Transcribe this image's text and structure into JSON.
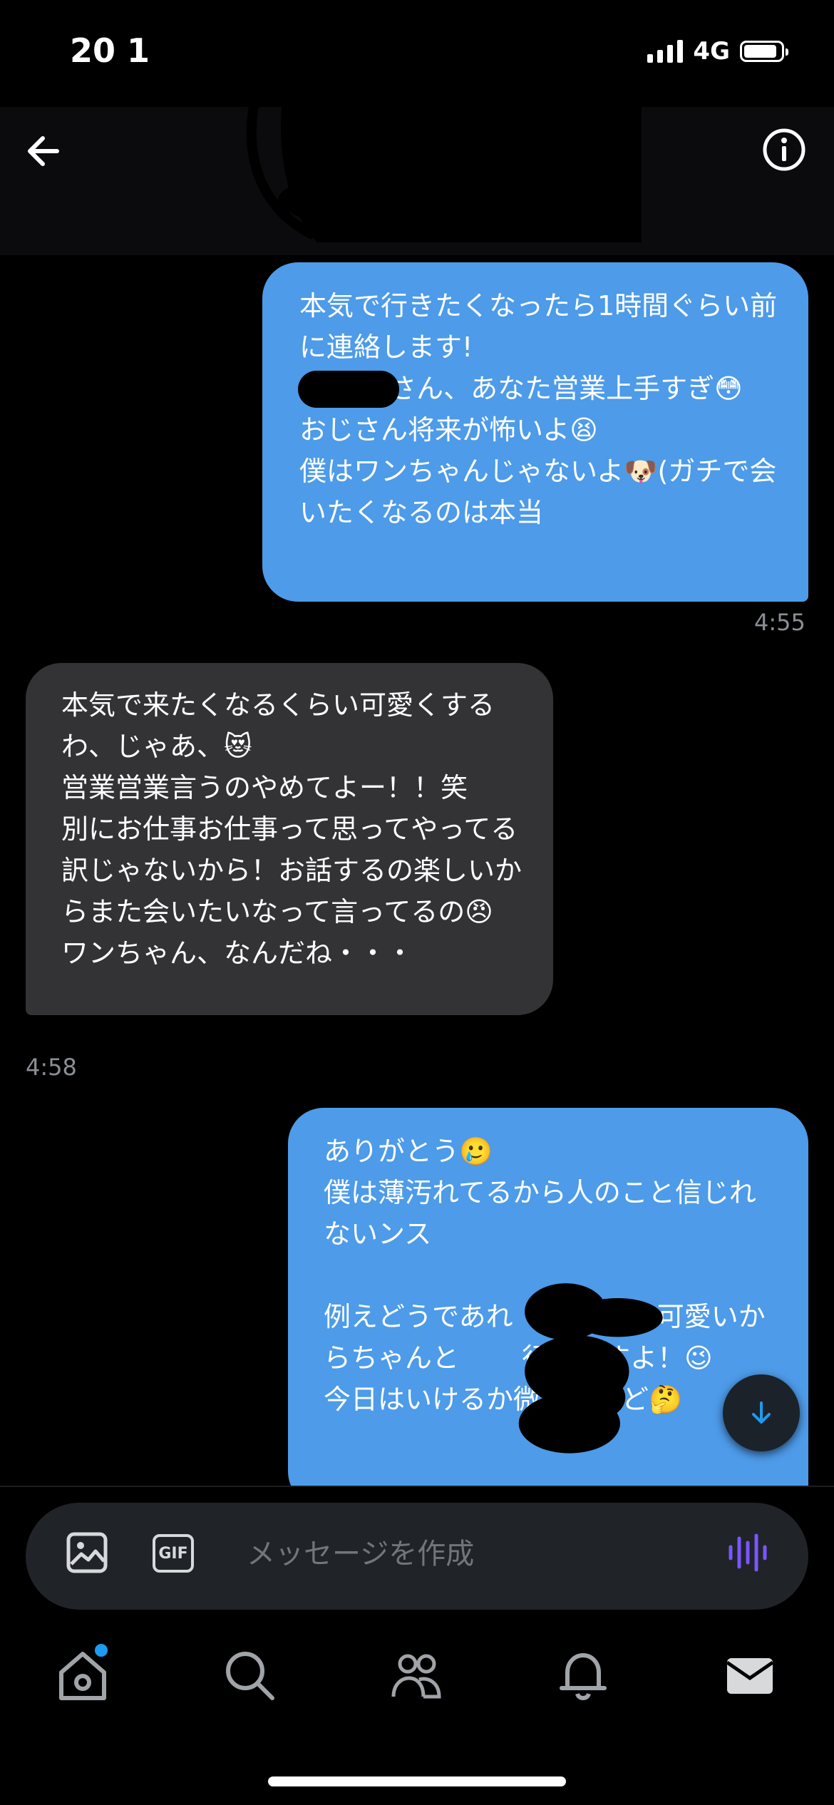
{
  "status_bar": {
    "time": "20 1",
    "network": "4G"
  },
  "header": {
    "back_icon": "arrow-left-icon",
    "info_icon": "info-circle-icon"
  },
  "messages": [
    {
      "direction": "sent",
      "text": "本気で行きたくなったら1時間ぐらい前に連絡します!\n　　　 さん、あなた営業上手すぎ😳\nおじさん将来が怖いよ😫\n僕はワンちゃんじゃないよ🐶(ガチで会いたくなるのは本当",
      "time": "4:55"
    },
    {
      "direction": "received",
      "text": "本気で来たくなるくらい可愛くするわ、じゃあ、😻\n営業営業言うのやめてよー！！笑\n別にお仕事お仕事って思ってやってる訳じゃないから！お話するの楽しいからまた会いたいなって言ってるの😠\nワンちゃん、なんだね・・・",
      "time": "4:58"
    },
    {
      "direction": "sent",
      "text": "ありがとう🥲\n僕は薄汚れてるから人のこと信じれないンス\n\n例えどうであれ　　　 さん可愛いからちゃんと　　 行きますよ！😉\n今日はいけるか微妙だけど🤔"
    }
  ],
  "composer": {
    "placeholder": "メッセージを作成",
    "gif_label": "GIF"
  },
  "tabs": [
    {
      "name": "home",
      "icon": "home-icon"
    },
    {
      "name": "search",
      "icon": "search-icon"
    },
    {
      "name": "communities",
      "icon": "people-icon"
    },
    {
      "name": "notifications",
      "icon": "bell-icon"
    },
    {
      "name": "messages",
      "icon": "mail-icon"
    }
  ],
  "colors": {
    "sent_bubble": "#4d9be9",
    "received_bubble": "#333336",
    "accent": "#1d9bf0",
    "voice": "#7856ff"
  }
}
